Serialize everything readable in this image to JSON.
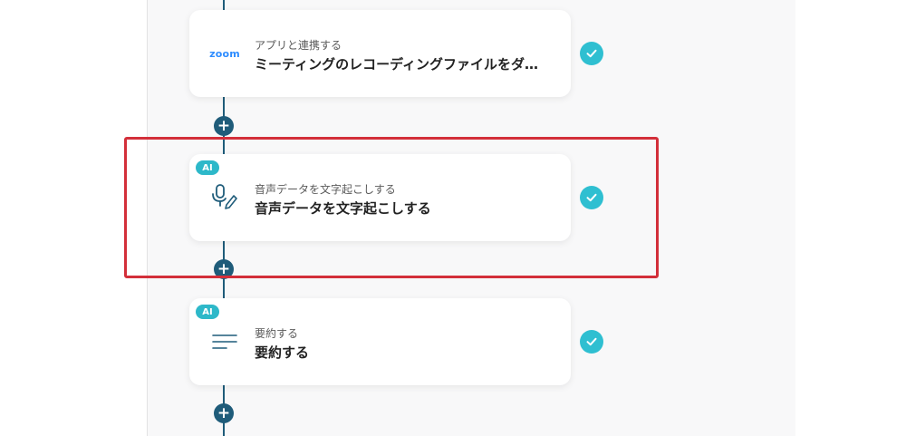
{
  "flow": {
    "steps": [
      {
        "icon": "zoom-logo",
        "logo_text": "zoom",
        "subtitle": "アプリと連携する",
        "title": "ミーティングのレコーディングファイルをダ…",
        "status": "completed"
      },
      {
        "icon": "microphone-pen-icon",
        "badge": "AI",
        "subtitle": "音声データを文字起こしする",
        "title": "音声データを文字起こしする",
        "status": "completed"
      },
      {
        "icon": "text-lines-icon",
        "badge": "AI",
        "subtitle": "要約する",
        "title": "要約する",
        "status": "completed"
      }
    ],
    "add_symbol": "+"
  },
  "colors": {
    "connector": "#1f5c7a",
    "check": "#2fbfd1",
    "ai_badge": "#2db8c9",
    "highlight": "#d32f3a",
    "zoom_brand": "#2d8cff"
  }
}
